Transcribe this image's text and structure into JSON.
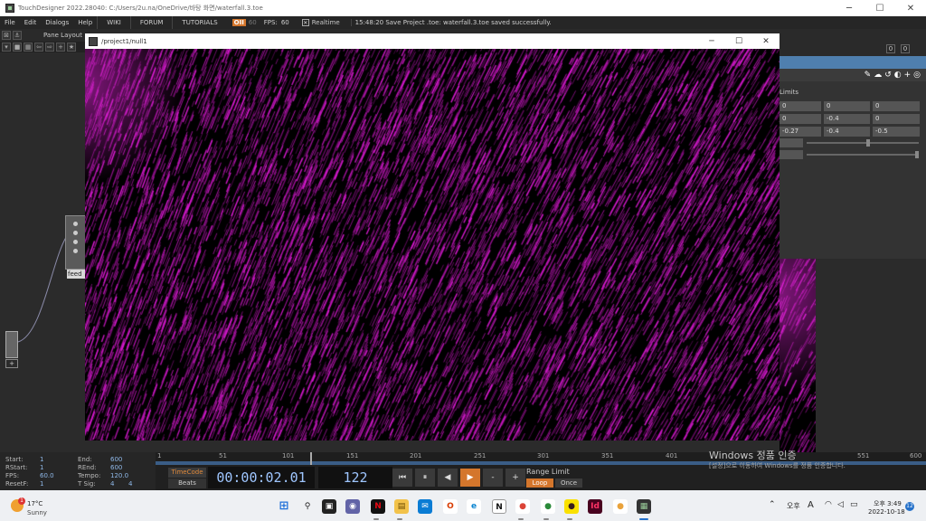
{
  "app": {
    "title": "TouchDesigner 2022.28040: C:/Users/2u.na/OneDrive/바탕 화면/waterfall.3.toe",
    "window_controls": {
      "minimize": "─",
      "maximize": "☐",
      "close": "✕"
    }
  },
  "menu": {
    "items": [
      "File",
      "Edit",
      "Dialogs",
      "Help"
    ],
    "links": [
      "WIKI",
      "FORUM",
      "TUTORIALS"
    ],
    "oi_badge": "OII",
    "fps_dim": "60",
    "fps_label": "FPS:",
    "fps_value": "60",
    "realtime_checked": "✕",
    "realtime_label": "Realtime",
    "status_message": "15:48:20 Save Project .toe: waterfall.3.toe saved successfully."
  },
  "toolbar": {
    "pane_layout_label": "Pane Layout"
  },
  "param_panel": {
    "header_numbers": [
      "0",
      "0"
    ],
    "limits_label": "Limits",
    "rows": [
      [
        "0",
        "0",
        "0"
      ],
      [
        "0",
        "-0.4",
        "0"
      ],
      [
        "-0.27",
        "-0.4",
        "-0.5"
      ]
    ],
    "slider_levels": [
      0.55,
      1.0
    ]
  },
  "network": {
    "node_label": "feed"
  },
  "viewer": {
    "title": "/project1/null1",
    "accent_color": "#e01ad8"
  },
  "timeline": {
    "ticks": [
      "1",
      "51",
      "101",
      "151",
      "201",
      "251",
      "301",
      "351",
      "401",
      "551",
      "600"
    ],
    "current_frame": 122,
    "range_start": 1,
    "range_end": 600
  },
  "time_info": {
    "labels": {
      "start": "Start:",
      "rstart": "RStart:",
      "fps": "FPS:",
      "resetf": "ResetF:",
      "end": "End:",
      "rend": "REnd:",
      "tempo": "Tempo:",
      "tsig": "T Sig:"
    },
    "values": {
      "start": "1",
      "rstart": "1",
      "fps": "60.0",
      "resetf": "1",
      "end": "600",
      "rend": "600",
      "tempo": "120.0",
      "tsig_a": "4",
      "tsig_b": "4"
    }
  },
  "transport": {
    "timecode_label": "TimeCode",
    "beats_label": "Beats",
    "time": "00:00:02.01",
    "frame": "122",
    "buttons": [
      "⏮",
      "⏸",
      "◀",
      "▶",
      "-",
      "+"
    ],
    "range_limit_label": "Range Limit",
    "loop_label": "Loop",
    "once_label": "Once"
  },
  "watermark": {
    "title": "Windows 정품 인증",
    "subtitle": "[설정]으로 이동하여 Windows를 정품 인증합니다."
  },
  "taskbar": {
    "weather_temp": "17°C",
    "weather_desc": "Sunny",
    "notification_count": "1",
    "ime_1": "오후",
    "ime_2": "A",
    "clock_time": "오후 3:49",
    "clock_date": "2022-10-18",
    "date_badge": "12"
  }
}
